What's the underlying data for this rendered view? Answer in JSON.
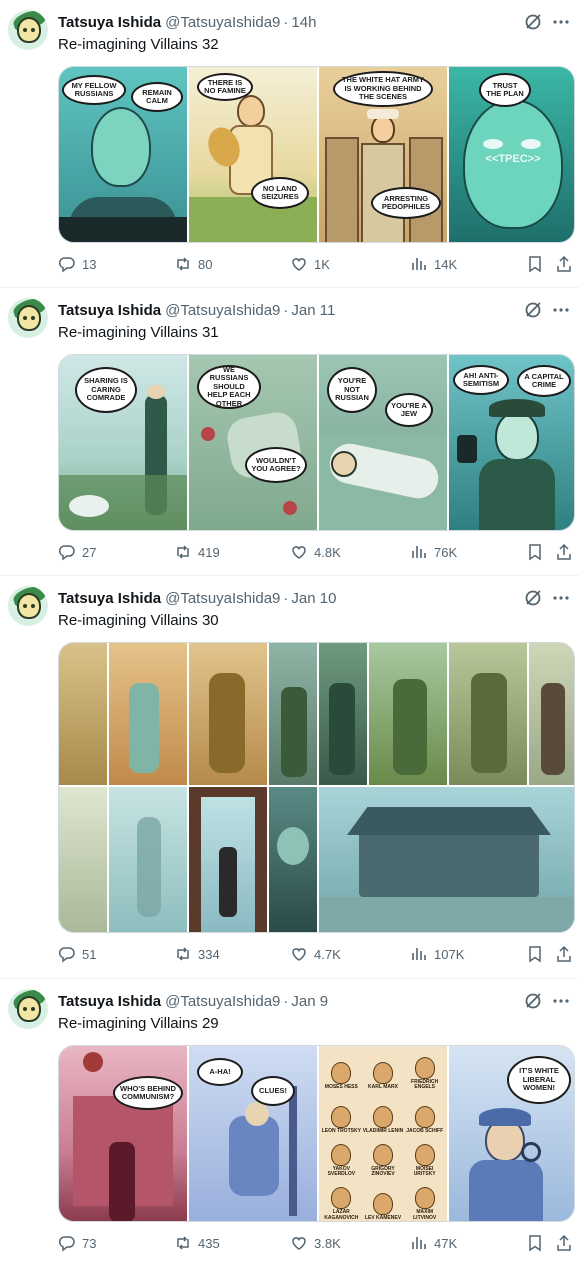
{
  "tweets": [
    {
      "author_name": "Tatsuya Ishida",
      "handle": "@TatsuyaIshida9",
      "separator": "·",
      "time": "14h",
      "text": "Re-imagining Villains 32",
      "panels": [
        {
          "bubbles": [
            "MY FELLOW RUSSIANS",
            "REMAIN CALM"
          ]
        },
        {
          "bubbles": [
            "THERE IS NO FAMINE",
            "NO LAND SEIZURES"
          ]
        },
        {
          "bubbles": [
            "THE WHITE HAT ARMY IS WORKING BEHIND THE SCENES",
            "ARRESTING PEDOPHILES"
          ]
        },
        {
          "bubbles": [
            "TRUST THE PLAN",
            "<<TPEC>>"
          ]
        }
      ],
      "stats": {
        "replies": "13",
        "reposts": "80",
        "likes": "1K",
        "views": "14K"
      }
    },
    {
      "author_name": "Tatsuya Ishida",
      "handle": "@TatsuyaIshida9",
      "separator": "·",
      "time": "Jan 11",
      "text": "Re-imagining Villains 31",
      "panels": [
        {
          "bubbles": [
            "SHARING IS CARING COMRADE"
          ]
        },
        {
          "bubbles": [
            "WE RUSSIANS SHOULD HELP EACH OTHER",
            "WOULDN'T YOU AGREE?"
          ]
        },
        {
          "bubbles": [
            "YOU'RE NOT RUSSIAN",
            "YOU'RE A JEW"
          ]
        },
        {
          "bubbles": [
            "AH! ANTI-SEMITISM",
            "A CAPITAL CRIME"
          ]
        }
      ],
      "stats": {
        "replies": "27",
        "reposts": "419",
        "likes": "4.8K",
        "views": "76K"
      }
    },
    {
      "author_name": "Tatsuya Ishida",
      "handle": "@TatsuyaIshida9",
      "separator": "·",
      "time": "Jan 10",
      "text": "Re-imagining Villains 30",
      "panels": [],
      "stats": {
        "replies": "51",
        "reposts": "334",
        "likes": "4.7K",
        "views": "107K"
      }
    },
    {
      "author_name": "Tatsuya Ishida",
      "handle": "@TatsuyaIshida9",
      "separator": "·",
      "time": "Jan 9",
      "text": "Re-imagining Villains 29",
      "panels": [
        {
          "bubbles": [
            "WHO'S BEHIND COMMUNISM?"
          ]
        },
        {
          "bubbles": [
            "A-HA!",
            "CLUES!"
          ]
        },
        {
          "labels": [
            "MOSES HESS",
            "KARL MARX",
            "FRIEDRICH ENGELS",
            "LEON TROTSKY",
            "VLADIMIR LENIN",
            "JACOB SCHIFF",
            "YAKOV SVERDLOV",
            "GRIGORY ZINOVIEV",
            "MOISEI URITSKY",
            "LAZAR KAGANOVICH",
            "LEV KAMENEV",
            "MAXIM LITVINOV"
          ]
        },
        {
          "bubbles": [
            "IT'S WHITE LIBERAL WOMEN!"
          ]
        }
      ],
      "stats": {
        "replies": "73",
        "reposts": "435",
        "likes": "3.8K",
        "views": "47K"
      }
    }
  ],
  "icons": {
    "reply": "reply-icon",
    "repost": "repost-icon",
    "like": "heart-icon",
    "views": "analytics-icon",
    "bookmark": "bookmark-icon",
    "share": "share-icon",
    "grok": "grok-icon",
    "more": "more-icon"
  },
  "colors": {
    "text_primary": "#0f1419",
    "text_secondary": "#536471",
    "divider": "#eff3f4"
  }
}
